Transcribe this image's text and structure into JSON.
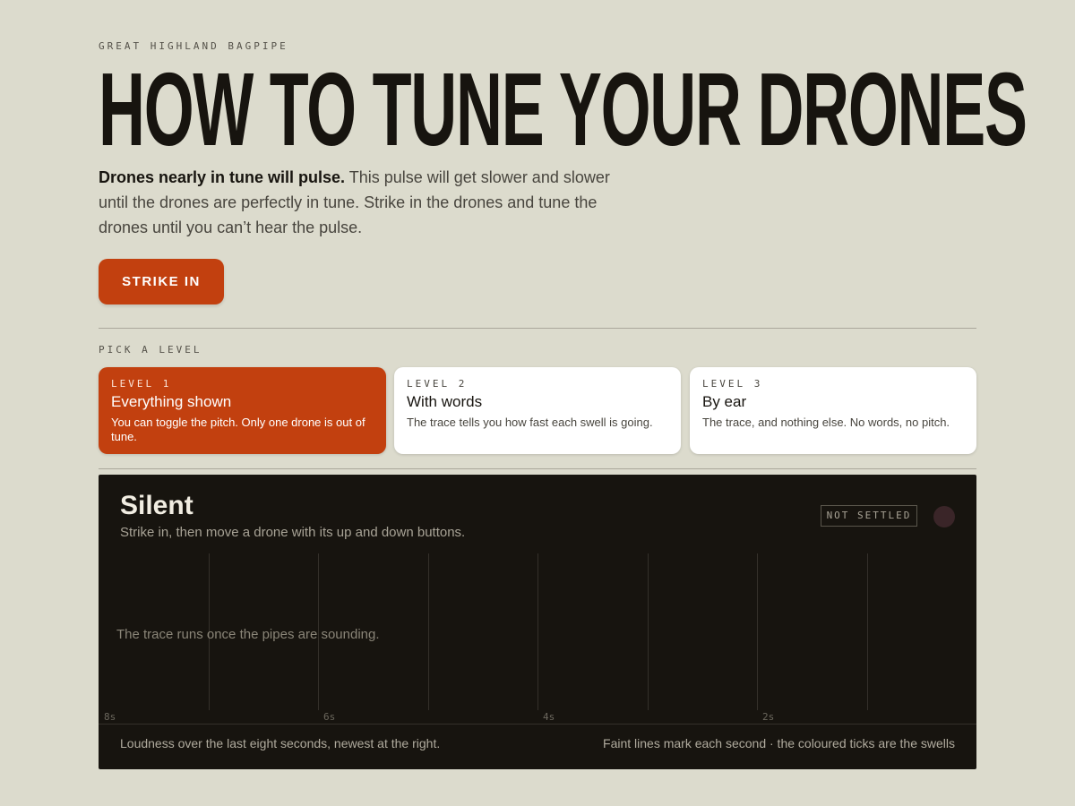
{
  "header": {
    "eyebrow": "GREAT HIGHLAND BAGPIPE",
    "title": "HOW TO TUNE YOUR DRONES",
    "intro_bold": "Drones nearly in tune will pulse.",
    "intro_rest": " This pulse will get slower and slower until the drones are perfectly in tune. Strike in the drones and tune the drones until you can’t hear the pulse.",
    "strike_label": "STRIKE IN"
  },
  "levels": {
    "label": "PICK A LEVEL",
    "items": [
      {
        "tag": "LEVEL 1",
        "name": "Everything shown",
        "desc": "You can toggle the pitch. Only one drone is out of tune."
      },
      {
        "tag": "LEVEL 2",
        "name": "With words",
        "desc": "The trace tells you how fast each swell is going."
      },
      {
        "tag": "LEVEL 3",
        "name": "By ear",
        "desc": "The trace, and nothing else. No words, no pitch."
      }
    ]
  },
  "panel": {
    "title": "Silent",
    "subtitle": "Strike in, then move a drone with its up and down buttons.",
    "status": "NOT SETTLED",
    "trace_message": "The trace runs once the pipes are sounding.",
    "ticks": [
      "8s",
      "6s",
      "4s",
      "2s"
    ],
    "footer_left": "Loudness over the last eight seconds, newest at the right.",
    "footer_right": "Faint lines mark each second · the coloured ticks are the swells"
  },
  "colors": {
    "background": "#dcdbcd",
    "accent": "#c2400f",
    "panel": "#17140f",
    "status_dot": "#3a2528"
  }
}
